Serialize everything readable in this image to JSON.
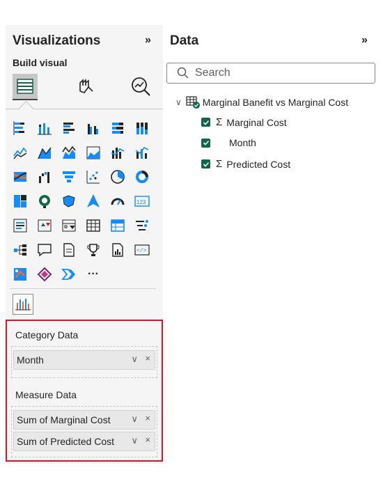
{
  "visualizations": {
    "title": "Visualizations",
    "expand_icon": "»",
    "build_label": "Build visual",
    "build_tabs": [
      {
        "name": "build-visual-tab",
        "icon": "table-grid-icon",
        "active": true
      },
      {
        "name": "format-visual-tab",
        "icon": "paintbrush-icon",
        "active": false
      },
      {
        "name": "analytics-tab",
        "icon": "magnifier-chart-icon",
        "active": false
      }
    ],
    "more_visuals": "···",
    "wells": {
      "category_title": "Category Data",
      "category_fields": [
        {
          "label": "Month"
        }
      ],
      "measure_title": "Measure Data",
      "measure_fields": [
        {
          "label": "Sum of Marginal Cost"
        },
        {
          "label": "Sum of Predicted Cost"
        }
      ],
      "chevron": "∨",
      "remove": "×"
    }
  },
  "data_pane": {
    "title": "Data",
    "expand_icon": "»",
    "search_placeholder": "Search",
    "table": {
      "name": "Marginal Banefit vs Marginal Cost",
      "fields": [
        {
          "label": "Marginal Cost",
          "sigma": "Σ",
          "checked": true
        },
        {
          "label": "Month",
          "sigma": "",
          "checked": true
        },
        {
          "label": "Predicted Cost",
          "sigma": "Σ",
          "checked": true
        }
      ]
    }
  },
  "colors": {
    "accent_green": "#13644a",
    "highlight_red": "#e81123",
    "icon_blue": "#118dff"
  }
}
